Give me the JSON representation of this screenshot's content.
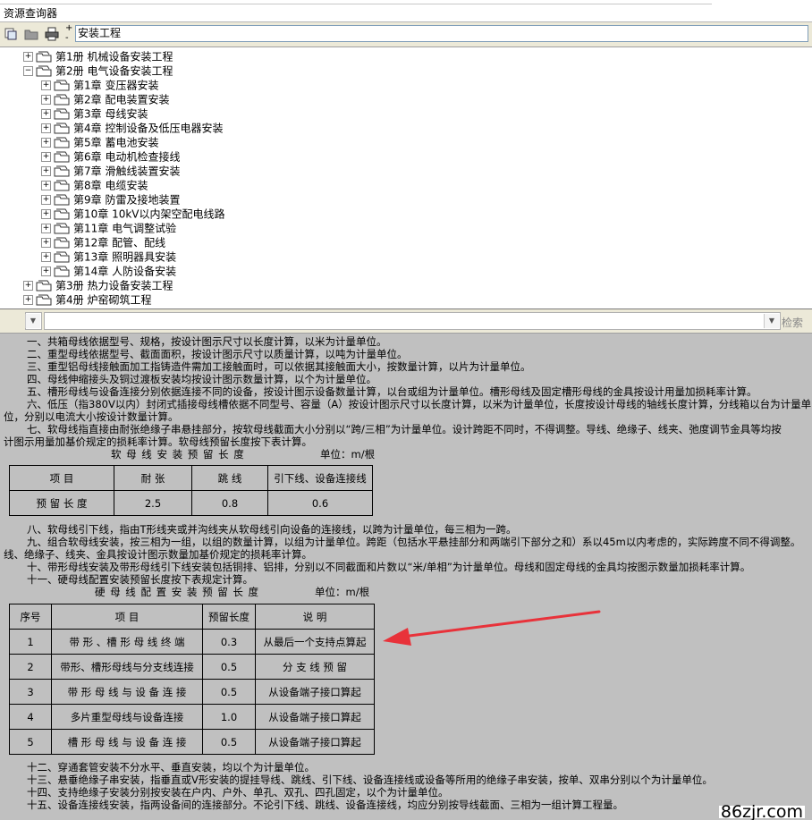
{
  "window": {
    "title": "资源查询器"
  },
  "toolbar": {
    "search_value": "安装工程",
    "plus": "+",
    "minus": "-"
  },
  "tree": {
    "books": [
      {
        "label": "第1册   机械设备安装工程",
        "expanded": false
      },
      {
        "label": "第2册   电气设备安装工程",
        "expanded": true
      }
    ],
    "chapters": [
      {
        "label": "第1章   变压器安装"
      },
      {
        "label": "第2章   配电装置安装"
      },
      {
        "label": "第3章   母线安装"
      },
      {
        "label": "第4章   控制设备及低压电器安装"
      },
      {
        "label": "第5章   蓄电池安装"
      },
      {
        "label": "第6章   电动机检查接线"
      },
      {
        "label": "第7章   滑触线装置安装"
      },
      {
        "label": "第8章   电缆安装"
      },
      {
        "label": "第9章   防雷及接地装置"
      },
      {
        "label": "第10章   10kV以内架空配电线路"
      },
      {
        "label": "第11章   电气调整试验"
      },
      {
        "label": "第12章   配管、配线"
      },
      {
        "label": "第13章   照明器具安装"
      },
      {
        "label": "第14章   人防设备安装"
      }
    ],
    "books_after": [
      {
        "label": "第3册   热力设备安装工程"
      },
      {
        "label": "第4册   炉窑砌筑工程"
      }
    ],
    "collapsed_sign": "+",
    "expanded_sign": "−"
  },
  "filter": {
    "search_label": "检索"
  },
  "content": {
    "lines1": [
      "一、共箱母线依据型号、规格，按设计图示尺寸以长度计算，以米为计量单位。",
      "二、重型母线依据型号、截面面积，按设计图示尺寸以质量计算，以吨为计量单位。",
      "三、重型铝母线接触面加工指铸造件需加工接触面时，可以依据其接触面大小，按数量计算，以片为计量单位。",
      "四、母线伸缩接头及铜过渡板安装均按设计图示数量计算，以个为计量单位。",
      "五、槽形母线与设备连接分别依据连接不同的设备，按设计图示设备数量计算，以台或组为计量单位。槽形母线及固定槽形母线的金具按设计用量加损耗率计算。",
      "六、低压（指380V以内）封闭式插接母线槽依据不同型号、容量（A）按设计图示尺寸以长度计算，以米为计量单位，长度按设计母线的轴线长度计算，分线箱以台为计量单",
      "位，分别以电流大小按设计数量计算。",
      "七、软母线指直接由耐张绝缘子串悬挂部分，按软母线截面大小分别以“跨/三相”为计量单位。设计跨距不同时，不得调整。导线、绝缘子、线夹、弛度调节金具等均按",
      "计图示用量加基价规定的损耗率计算。软母线预留长度按下表计算。"
    ],
    "table1": {
      "title": "软 母 线 安 装 预 留 长 度",
      "unit": "单位：m/根",
      "headers": [
        "项    目",
        "耐    张",
        "跳    线",
        "引下线、设备连接线"
      ],
      "row": [
        "预  留  长  度",
        "2.5",
        "0.8",
        "0.6"
      ]
    },
    "lines2": [
      "八、软母线引下线，指由T形线夹或并沟线夹从软母线引向设备的连接线，以跨为计量单位，每三相为一跨。",
      "九、组合软母线安装，按三相为一组，以组的数量计算，以组为计量单位。跨距（包括水平悬挂部分和两端引下部分之和）系以45m以内考虑的，实际跨度不同不得调整。",
      "线、绝缘子、线夹、金具按设计图示数量加基价规定的损耗率计算。",
      "十、带形母线安装及带形母线引下线安装包括铜排、铝排，分别以不同截面和片数以“米/单相”为计量单位。母线和固定母线的金具均按图示数量加损耗率计算。",
      "十一、硬母线配置安装预留长度按下表规定计算。"
    ],
    "table2": {
      "title": "硬 母 线 配 置 安 装 预 留 长 度",
      "unit": "单位：m/根",
      "headers": [
        "序号",
        "项          目",
        "预留长度",
        "说        明"
      ],
      "rows": [
        [
          "1",
          "带 形 、槽 形 母 线 终 端",
          "0.3",
          "从最后一个支持点算起"
        ],
        [
          "2",
          "带形、槽形母线与分支线连接",
          "0.5",
          "分  支  线  预  留"
        ],
        [
          "3",
          "带 形 母 线 与 设 备 连 接",
          "0.5",
          "从设备端子接口算起"
        ],
        [
          "4",
          "多片重型母线与设备连接",
          "1.0",
          "从设备端子接口算起"
        ],
        [
          "5",
          "槽 形 母 线 与 设 备 连 接",
          "0.5",
          "从设备端子接口算起"
        ]
      ]
    },
    "lines3": [
      "十二、穿通套管安装不分水平、垂直安装，均以个为计量单位。",
      "十三、悬垂绝缘子串安装，指垂直或V形安装的提挂导线、跳线、引下线、设备连接线或设备等所用的绝缘子串安装，按单、双串分别以个为计量单位。",
      "十四、支持绝缘子安装分别按安装在户内、户外、单孔、双孔、四孔固定，以个为计量单位。",
      "十五、设备连接线安装，指两设备间的连接部分。不论引下线、跳线、设备连接线，均应分别按导线截面、三相为一组计算工程量。"
    ],
    "watermark": "86zjr.com"
  },
  "colors": {
    "content_bg": "#c0c0c0",
    "annotation_arrow": "#e8323a",
    "toolbar_bg": "#ece9d8"
  }
}
